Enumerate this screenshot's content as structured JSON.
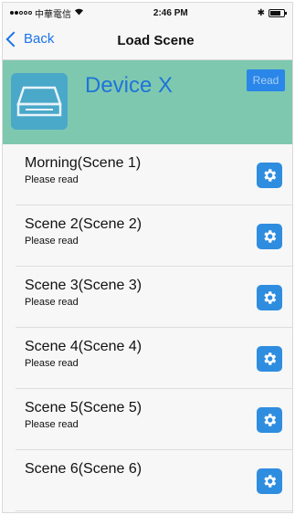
{
  "status_bar": {
    "carrier": "中華電信",
    "time": "2:46 PM",
    "bluetooth": "✱"
  },
  "nav": {
    "back_label": "Back",
    "title": "Load Scene"
  },
  "device": {
    "name": "Device X",
    "read_label": "Read",
    "info_line_1": "",
    "info_line_2": "",
    "icon": "router-device-icon",
    "header_color": "#7fc8b0"
  },
  "scenes": [
    {
      "name": "Morning(Scene 1)",
      "status": "Please read"
    },
    {
      "name": "Scene 2(Scene 2)",
      "status": "Please read"
    },
    {
      "name": "Scene 3(Scene 3)",
      "status": "Please read"
    },
    {
      "name": "Scene 4(Scene 4)",
      "status": "Please read"
    },
    {
      "name": "Scene 5(Scene 5)",
      "status": "Please read"
    },
    {
      "name": "Scene 6(Scene 6)",
      "status": ""
    }
  ],
  "accent_color": "#2f8de0"
}
